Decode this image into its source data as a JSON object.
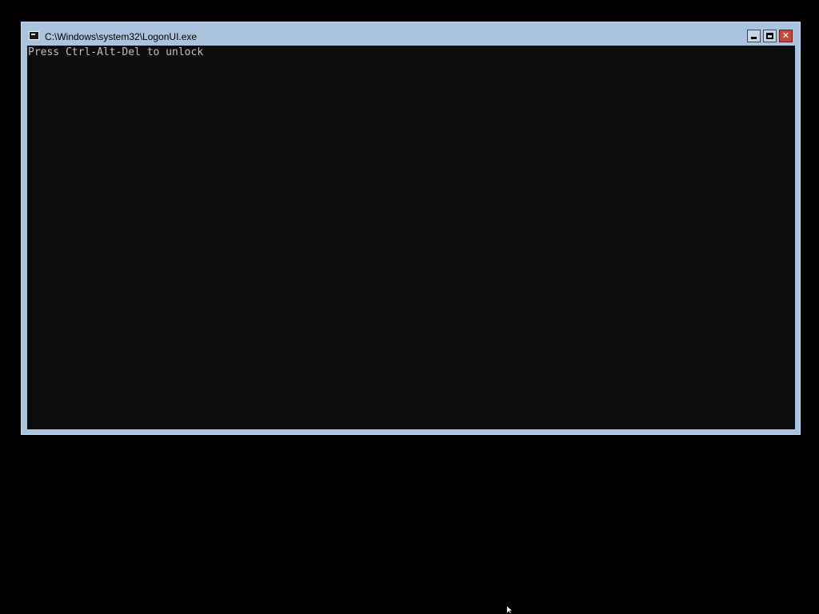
{
  "window": {
    "title": "C:\\Windows\\system32\\LogonUI.exe",
    "icon": "console-app-icon",
    "controls": {
      "minimize_icon": "minimize-icon",
      "maximize_icon": "maximize-icon",
      "close_icon": "close-icon",
      "close_glyph": "✕"
    }
  },
  "console": {
    "lines": [
      "Press Ctrl-Alt-Del to unlock"
    ],
    "background": "#0c0c0c",
    "text_color": "#c0c0c0"
  },
  "colors": {
    "desktop": "#000000",
    "window_frame": "#aac4df",
    "close_button": "#c9463d"
  },
  "cursor": {
    "icon": "mouse-pointer-icon"
  }
}
